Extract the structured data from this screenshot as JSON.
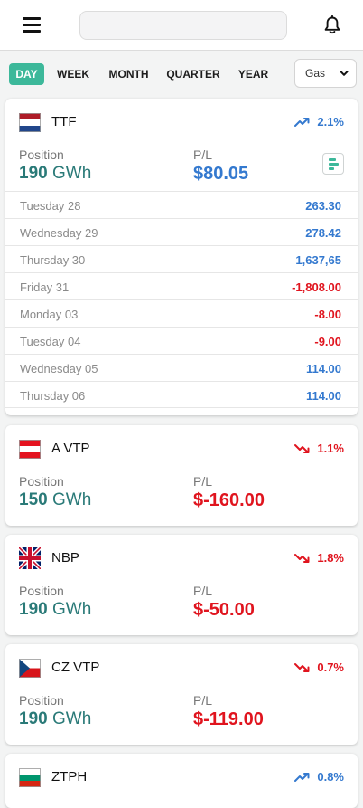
{
  "header": {
    "menu_icon": "hamburger-menu-icon",
    "search_placeholder": "",
    "search_value": "",
    "bell_icon": "bell-icon"
  },
  "periods": [
    {
      "label": "DAY",
      "active": true
    },
    {
      "label": "WEEK",
      "active": false
    },
    {
      "label": "MONTH",
      "active": false
    },
    {
      "label": "QUARTER",
      "active": false
    },
    {
      "label": "YEAR",
      "active": false
    }
  ],
  "commodity": {
    "selected": "Gas"
  },
  "colors": {
    "accent": "#3cb89a",
    "position": "#2a7a78",
    "positive": "#3479cf",
    "negative": "#e0141e"
  },
  "markets": [
    {
      "name": "TTF",
      "flag": "netherlands-flag-icon",
      "trend": "up",
      "change": "2.1%",
      "position_label": "Position",
      "position_value": "190",
      "position_unit": "GWh",
      "pl_label": "P/L",
      "pl_value": "$80.05",
      "days": [
        {
          "day": "Tuesday 28",
          "value": "263.30",
          "dir": "up"
        },
        {
          "day": "Wednesday 29",
          "value": "278.42",
          "dir": "up"
        },
        {
          "day": "Thursday 30",
          "value": "1,637,65",
          "dir": "up"
        },
        {
          "day": "Friday 31",
          "value": "-1,808.00",
          "dir": "down"
        },
        {
          "day": "Monday 03",
          "value": "-8.00",
          "dir": "down"
        },
        {
          "day": "Tuesday 04",
          "value": "-9.00",
          "dir": "down"
        },
        {
          "day": "Wednesday 05",
          "value": "114.00",
          "dir": "up"
        },
        {
          "day": "Thursday 06",
          "value": "114.00",
          "dir": "up"
        }
      ]
    },
    {
      "name": "A VTP",
      "flag": "austria-flag-icon",
      "trend": "down",
      "change": "1.1%",
      "position_label": "Position",
      "position_value": "150",
      "position_unit": "GWh",
      "pl_label": "P/L",
      "pl_value": "$-160.00"
    },
    {
      "name": "NBP",
      "flag": "uk-flag-icon",
      "trend": "down",
      "change": "1.8%",
      "position_label": "Position",
      "position_value": "190",
      "position_unit": "GWh",
      "pl_label": "P/L",
      "pl_value": "$-50.00"
    },
    {
      "name": "CZ VTP",
      "flag": "czech-flag-icon",
      "trend": "down",
      "change": "0.7%",
      "position_label": "Position",
      "position_value": "190",
      "position_unit": "GWh",
      "pl_label": "P/L",
      "pl_value": "$-119.00"
    },
    {
      "name": "ZTPH",
      "flag": "bulgaria-flag-icon",
      "trend": "up",
      "change": "0.8%"
    }
  ]
}
